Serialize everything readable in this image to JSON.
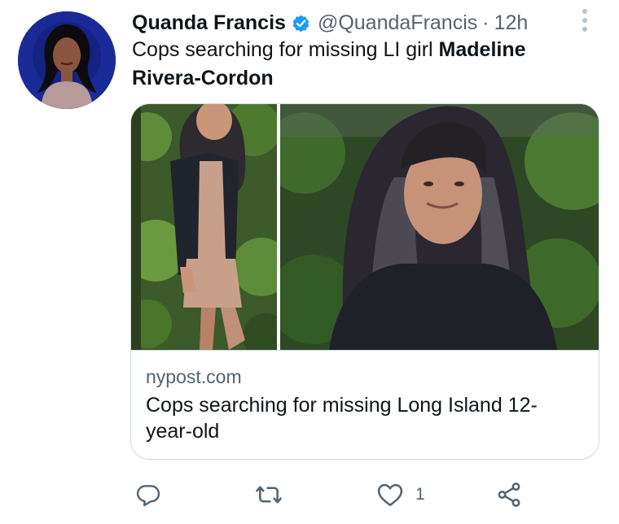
{
  "tweet": {
    "author": {
      "display_name": "Quanda Francis",
      "verified": true,
      "handle": "@QuandaFrancis",
      "separator": "·",
      "timestamp": "12h",
      "avatar_icon": "profile-photo"
    },
    "text_plain": "Cops searching for missing LI girl ",
    "text_bold": "Madeline Rivera-Cordon",
    "card": {
      "domain": "nypost.com",
      "title": "Cops searching for missing Long Island 12-year-old",
      "images": [
        "photo-girl-standing",
        "photo-girl-closeup"
      ]
    },
    "actions": {
      "reply_icon": "reply-icon",
      "retweet_icon": "retweet-icon",
      "like_icon": "heart-icon",
      "like_count": "1",
      "share_icon": "share-icon"
    }
  },
  "colors": {
    "text_primary": "#0f1419",
    "text_secondary": "#536471",
    "verified_blue": "#1d9bf0",
    "border": "#cfd9de"
  }
}
